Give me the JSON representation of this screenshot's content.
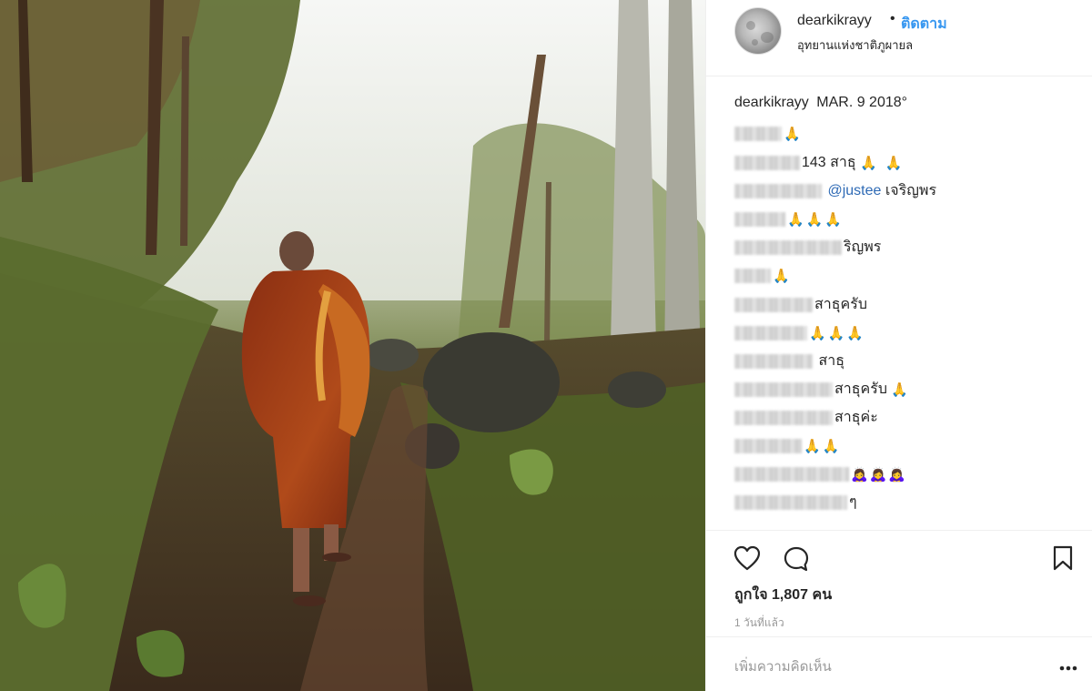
{
  "post": {
    "photo_alt": "monk-walking-forest-path"
  },
  "header": {
    "username": "dearkikrayy",
    "separator": "•",
    "follow_label": "ติดตาม",
    "location": "อุทยานแห่งชาติภูผายล"
  },
  "caption": {
    "username": "dearkikrayy",
    "text": "MAR. 9 2018°"
  },
  "comments": [
    {
      "text": "",
      "emoji": "🙏"
    },
    {
      "text": "143 สาธุ",
      "emoji": "🙏 🙏"
    },
    {
      "mention": "@justee",
      "text": " เจริญพร",
      "emoji": ""
    },
    {
      "text": "",
      "emoji": "🙏🙏🙏"
    },
    {
      "text": "ริญพร",
      "emoji": ""
    },
    {
      "text": "",
      "emoji": "🙏"
    },
    {
      "text": "สาธุครับ",
      "emoji": ""
    },
    {
      "text": "",
      "emoji": "🙏🙏🙏"
    },
    {
      "text": " สาธุ",
      "emoji": ""
    },
    {
      "text": "สาธุครับ",
      "emoji": "🙏"
    },
    {
      "text": "สาธุค่ะ",
      "emoji": ""
    },
    {
      "text": "",
      "emoji": "🙏🙏"
    },
    {
      "text": "",
      "emoji": "🙇‍♀️🙇‍♀️🙇‍♀️"
    },
    {
      "text": "ๆ",
      "emoji": ""
    }
  ],
  "actions": {
    "like_icon": "heart-icon",
    "comment_icon": "comment-bubble-icon",
    "save_icon": "bookmark-icon",
    "likes_text": "ถูกใจ 1,807 คน",
    "timestamp": "1 วันที่แล้ว"
  },
  "add_comment": {
    "placeholder": "เพิ่มความคิดเห็น",
    "more_icon": "more-options-icon"
  },
  "colors": {
    "link": "#3897f0",
    "mention": "#2e6ab5",
    "text": "#262626",
    "muted": "#999999",
    "divider": "#efefef"
  }
}
